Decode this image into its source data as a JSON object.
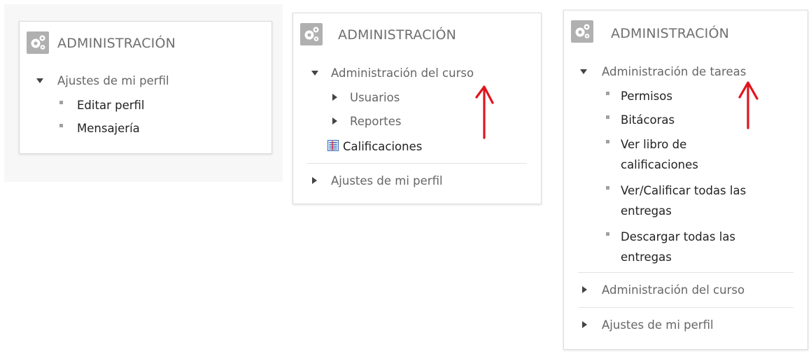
{
  "panels": [
    {
      "title": "ADMINISTRACIÓN",
      "items": [
        {
          "type": "expanded",
          "label": "Ajustes de mi perfil"
        },
        {
          "type": "leaf",
          "label": "Editar perfil"
        },
        {
          "type": "leaf",
          "label": "Mensajería"
        }
      ]
    },
    {
      "title": "ADMINISTRACIÓN",
      "items": [
        {
          "type": "expanded",
          "label": "Administración del curso"
        },
        {
          "type": "collapsed",
          "label": "Usuarios"
        },
        {
          "type": "collapsed",
          "label": "Reportes"
        },
        {
          "type": "icon-leaf",
          "label": "Calificaciones",
          "icon": "grades-icon"
        },
        {
          "type": "collapsed",
          "label": "Ajustes de mi perfil"
        }
      ]
    },
    {
      "title": "ADMINISTRACIÓN",
      "items": [
        {
          "type": "expanded",
          "label": "Administración de tareas"
        },
        {
          "type": "leaf",
          "label": "Permisos"
        },
        {
          "type": "leaf",
          "label": "Bitácoras"
        },
        {
          "type": "leaf",
          "lines": [
            "Ver libro de",
            "calificaciones"
          ]
        },
        {
          "type": "leaf",
          "lines": [
            "Ver/Calificar todas las",
            "entregas"
          ]
        },
        {
          "type": "leaf",
          "lines": [
            "Descargar todas las",
            "entregas"
          ]
        },
        {
          "type": "collapsed",
          "label": "Administración del curso"
        },
        {
          "type": "collapsed",
          "label": "Ajustes de mi perfil"
        }
      ]
    }
  ],
  "colors": {
    "header_text": "#6f6f6f",
    "icon_bg": "#b0b0b0",
    "annotation_arrow": "#e0141e"
  },
  "icons": [
    "gears-icon",
    "triangle-down-icon",
    "triangle-right-icon",
    "bullet-icon",
    "grades-icon",
    "red-arrow-up-icon"
  ]
}
